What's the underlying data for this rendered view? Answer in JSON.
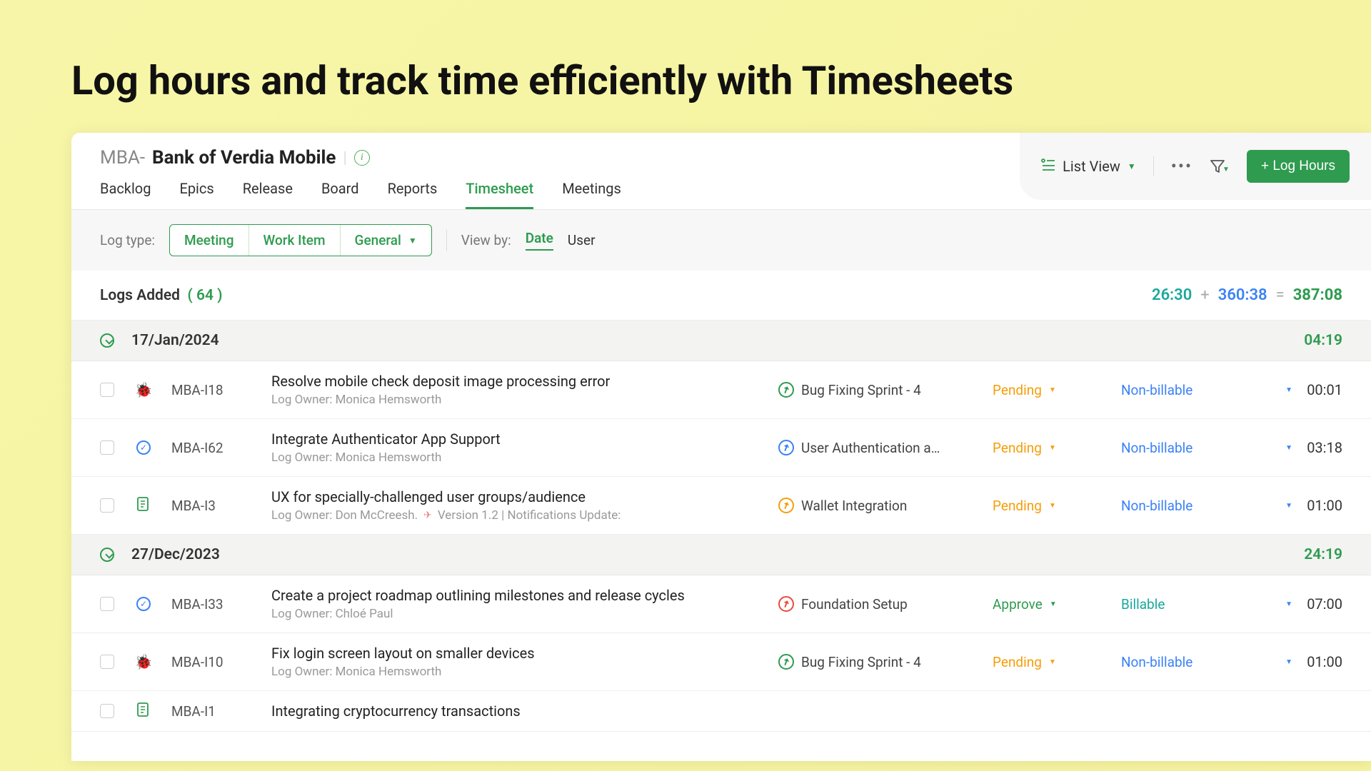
{
  "page_heading": "Log hours and track time efficiently with Timesheets",
  "project": {
    "prefix": "MBA-",
    "name": "Bank of Verdia Mobile"
  },
  "nav": [
    "Backlog",
    "Epics",
    "Release",
    "Board",
    "Reports",
    "Timesheet",
    "Meetings"
  ],
  "nav_active": "Timesheet",
  "toolbar": {
    "view_mode": "List View",
    "log_hours_btn": "+ Log Hours"
  },
  "filterbar": {
    "logtype_label": "Log type:",
    "logtype_options": [
      "Meeting",
      "Work Item",
      "General"
    ],
    "viewby_label": "View by:",
    "viewby_date": "Date",
    "viewby_user": "User"
  },
  "summary": {
    "label": "Logs Added",
    "count": "( 64 )",
    "t1": "26:30",
    "plus": "+",
    "t2": "360:38",
    "eq": "=",
    "total": "387:08"
  },
  "groups": [
    {
      "date": "17/Jan/2024",
      "total": "04:19",
      "rows": [
        {
          "type": "bug",
          "id": "MBA-I18",
          "title": "Resolve mobile check deposit image processing error",
          "owner": "Log Owner: Monica Hemsworth",
          "epic": "Bug Fixing Sprint - 4",
          "epic_c": "green",
          "status": "Pending",
          "bill": "Non-billable",
          "time": "00:01"
        },
        {
          "type": "task",
          "id": "MBA-I62",
          "title": "Integrate Authenticator App Support",
          "owner": "Log Owner: Monica Hemsworth",
          "epic": "User Authentication a…",
          "epic_c": "blue",
          "status": "Pending",
          "bill": "Non-billable",
          "time": "03:18"
        },
        {
          "type": "doc",
          "id": "MBA-I3",
          "title": "UX for specially-challenged user groups/audience",
          "owner": "Log Owner: Don McCreesh.",
          "extra": "Version 1.2 | Notifications Update:",
          "epic": "Wallet Integration",
          "epic_c": "orange",
          "status": "Pending",
          "bill": "Non-billable",
          "time": "01:00"
        }
      ]
    },
    {
      "date": "27/Dec/2023",
      "total": "24:19",
      "rows": [
        {
          "type": "task",
          "id": "MBA-I33",
          "title": "Create a project roadmap outlining milestones and release cycles",
          "owner": "Log Owner: Chloé Paul",
          "epic": "Foundation Setup",
          "epic_c": "red",
          "status": "Approve",
          "bill": "Billable",
          "time": "07:00"
        },
        {
          "type": "bug",
          "id": "MBA-I10",
          "title": "Fix login screen layout on smaller devices",
          "owner": "Log Owner: Monica Hemsworth",
          "epic": "Bug Fixing Sprint - 4",
          "epic_c": "green",
          "status": "Pending",
          "bill": "Non-billable",
          "time": "01:00"
        },
        {
          "type": "doc",
          "id": "MBA-I1",
          "title": "Integrating cryptocurrency transactions",
          "owner": "",
          "epic": "",
          "epic_c": "green",
          "status": "",
          "bill": "",
          "time": ""
        }
      ]
    }
  ]
}
